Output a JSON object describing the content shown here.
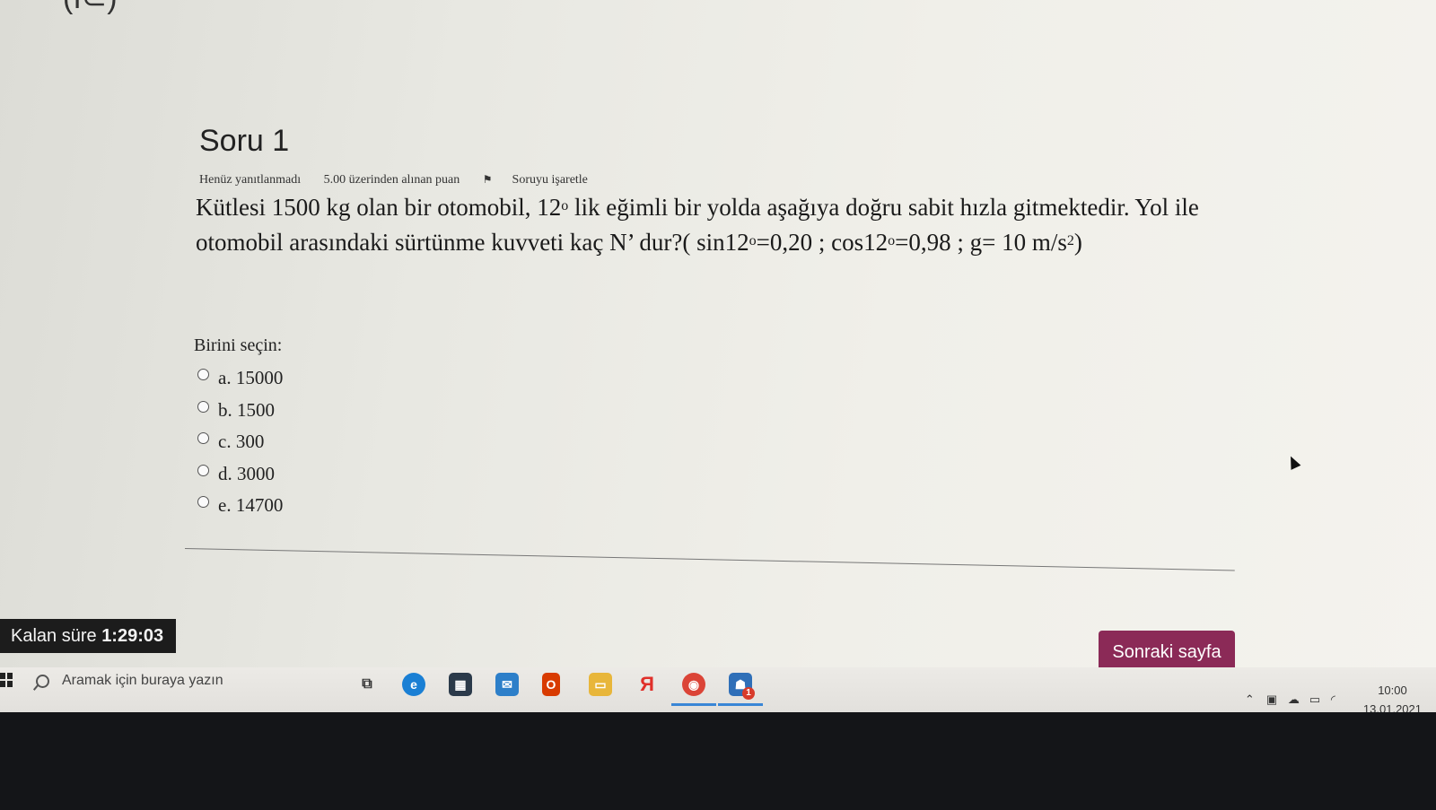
{
  "question": {
    "title": "Soru 1",
    "status": "Henüz yanıtlanmadı",
    "points": "5.00 üzerinden alınan puan",
    "flag_label": "Soruyu işaretle",
    "text_p1": "Kütlesi 1500 kg olan bir otomobil, 12",
    "text_deg1": "o",
    "text_p2": " lik eğimli bir yolda aşağıya doğru sabit hızla gitmektedir. Yol ile otomobil arasındaki sürtünme kuvveti kaç N’ dur?( sin12",
    "text_deg2": "o",
    "text_p3": "=0,20 ;  cos12",
    "text_deg3": "o",
    "text_p4": "=0,98  ; g= 10 m/s",
    "text_sq": "2",
    "text_p5": ")",
    "choose_label": "Birini seçin:",
    "options": [
      "a. 15000",
      "b. 1500",
      "c. 300",
      "d. 3000",
      "e. 14700"
    ]
  },
  "timer": {
    "label": "Kalan süre",
    "value": "1:29:03"
  },
  "next_button": "Sonraki sayfa",
  "taskbar": {
    "search_placeholder": "Aramak için buraya yazın",
    "badge": "1",
    "time": "10:00",
    "date": "13.01.2021",
    "icons": [
      "task-view-icon",
      "edge-icon",
      "store-icon",
      "mail-icon",
      "office-icon",
      "file-explorer-icon",
      "yandex-icon",
      "chrome-icon",
      "app-notification-icon"
    ]
  },
  "colors": {
    "accent": "#8b2a57",
    "timer_bg": "#1c1c1c"
  }
}
